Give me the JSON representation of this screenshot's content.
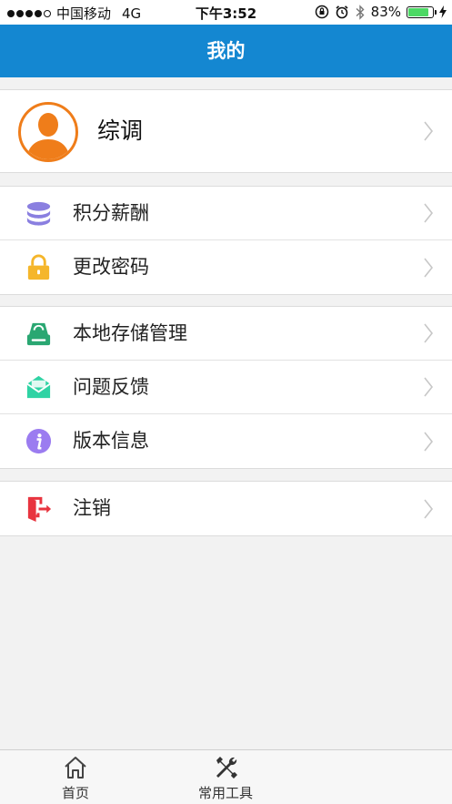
{
  "status_bar": {
    "carrier": "中国移动",
    "network": "4G",
    "time": "下午3:52",
    "battery_percent": "83%",
    "battery_level": 0.83
  },
  "navbar": {
    "title": "我的"
  },
  "profile": {
    "name": "综调"
  },
  "menu_groups": [
    [
      {
        "label": "积分薪酬",
        "icon": "database-icon",
        "color": "#8a7fe0"
      },
      {
        "label": "更改密码",
        "icon": "lock-icon",
        "color": "#f5b62b"
      }
    ],
    [
      {
        "label": "本地存储管理",
        "icon": "storage-icon",
        "color": "#2aa772"
      },
      {
        "label": "问题反馈",
        "icon": "envelope-icon",
        "color": "#2fd3a4"
      },
      {
        "label": "版本信息",
        "icon": "info-icon",
        "color": "#9b7cf0"
      }
    ],
    [
      {
        "label": "注销",
        "icon": "logout-icon",
        "color": "#e8343f"
      }
    ]
  ],
  "tabbar": {
    "items": [
      {
        "label": "首页",
        "icon": "home-icon"
      },
      {
        "label": "常用工具",
        "icon": "tools-icon"
      }
    ]
  },
  "colors": {
    "navbar_bg": "#1487d1",
    "avatar_ring": "#ef7d1a"
  }
}
